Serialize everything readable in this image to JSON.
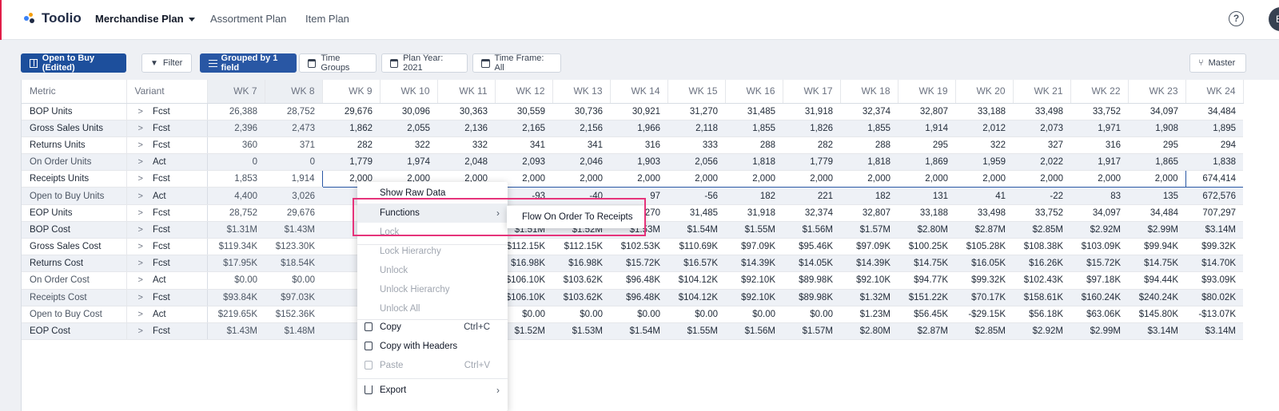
{
  "app": {
    "name": "Toolio"
  },
  "nav": {
    "items": [
      {
        "label": "Merchandise Plan",
        "active": true,
        "dropdown": true
      },
      {
        "label": "Assortment Plan"
      },
      {
        "label": "Item Plan"
      }
    ],
    "help_icon": "question-circle-icon",
    "avatar_initial": "B"
  },
  "toolbar": {
    "view_label": "Open to Buy (Edited)",
    "filter_label": "Filter",
    "grouped_label": "Grouped by 1 field",
    "time_groups_label": "Time Groups",
    "plan_year_label": "Plan Year: 2021",
    "time_frame_label": "Time Frame: All",
    "master_label": "Master"
  },
  "table": {
    "col_metric": "Metric",
    "col_variant": "Variant",
    "weeks": [
      "WK 7",
      "WK 8",
      "WK 9",
      "WK 10",
      "WK 11",
      "WK 12",
      "WK 13",
      "WK 14",
      "WK 15",
      "WK 16",
      "WK 17",
      "WK 18",
      "WK 19",
      "WK 20",
      "WK 21",
      "WK 22",
      "WK 23",
      "WK 24"
    ],
    "rows": [
      {
        "metric": "BOP Units",
        "variant": "Fcst",
        "values": [
          "26,388",
          "28,752",
          "29,676",
          "30,096",
          "30,363",
          "30,559",
          "30,736",
          "30,921",
          "31,270",
          "31,485",
          "31,918",
          "32,374",
          "32,807",
          "33,188",
          "33,498",
          "33,752",
          "34,097",
          "34,484"
        ]
      },
      {
        "metric": "Gross Sales Units",
        "variant": "Fcst",
        "values": [
          "2,396",
          "2,473",
          "1,862",
          "2,055",
          "2,136",
          "2,165",
          "2,156",
          "1,966",
          "2,118",
          "1,855",
          "1,826",
          "1,855",
          "1,914",
          "2,012",
          "2,073",
          "1,971",
          "1,908",
          "1,895"
        ]
      },
      {
        "metric": "Returns Units",
        "variant": "Fcst",
        "values": [
          "360",
          "371",
          "282",
          "322",
          "332",
          "341",
          "341",
          "316",
          "333",
          "288",
          "282",
          "288",
          "295",
          "322",
          "327",
          "316",
          "295",
          "294"
        ]
      },
      {
        "metric": "On Order Units",
        "variant": "Act",
        "values": [
          "0",
          "0",
          "1,779",
          "1,974",
          "2,048",
          "2,093",
          "2,046",
          "1,903",
          "2,056",
          "1,818",
          "1,779",
          "1,818",
          "1,869",
          "1,959",
          "2,022",
          "1,917",
          "1,865",
          "1,838"
        ]
      },
      {
        "metric": "Receipts Units",
        "variant": "Fcst",
        "values": [
          "1,853",
          "1,914",
          "2,000",
          "2,000",
          "2,000",
          "2,000",
          "2,000",
          "2,000",
          "2,000",
          "2,000",
          "2,000",
          "2,000",
          "2,000",
          "2,000",
          "2,000",
          "2,000",
          "2,000",
          "674,414"
        ]
      },
      {
        "metric": "Open to Buy Units",
        "variant": "Act",
        "values": [
          "4,400",
          "3,026",
          "",
          "",
          "",
          "-93",
          "-40",
          "97",
          "-56",
          "182",
          "221",
          "182",
          "131",
          "41",
          "-22",
          "83",
          "135",
          "672,576"
        ]
      },
      {
        "metric": "EOP Units",
        "variant": "Fcst",
        "values": [
          "28,752",
          "29,676",
          "30",
          "",
          "",
          "",
          "",
          "1,270",
          "31,485",
          "31,918",
          "32,374",
          "32,807",
          "33,188",
          "33,498",
          "33,752",
          "34,097",
          "34,484",
          "707,297"
        ]
      },
      {
        "metric": "BOP Cost",
        "variant": "Fcst",
        "values": [
          "$1.31M",
          "$1.43M",
          "$1",
          "",
          "",
          "$1.51M",
          "$1.52M",
          "$1.53M",
          "$1.54M",
          "$1.55M",
          "$1.56M",
          "$1.57M",
          "$2.80M",
          "$2.87M",
          "$2.85M",
          "$2.92M",
          "$2.99M",
          "$3.14M"
        ]
      },
      {
        "metric": "Gross Sales Cost",
        "variant": "Fcst",
        "values": [
          "$119.34K",
          "$123.30K",
          "$95",
          "",
          "",
          "$112.15K",
          "$112.15K",
          "$102.53K",
          "$110.69K",
          "$97.09K",
          "$95.46K",
          "$97.09K",
          "$100.25K",
          "$105.28K",
          "$108.38K",
          "$103.09K",
          "$99.94K",
          "$99.32K"
        ]
      },
      {
        "metric": "Returns Cost",
        "variant": "Fcst",
        "values": [
          "$17.95K",
          "$18.54K",
          "$14",
          "",
          "",
          "$16.98K",
          "$16.98K",
          "$15.72K",
          "$16.57K",
          "$14.39K",
          "$14.05K",
          "$14.39K",
          "$14.75K",
          "$16.05K",
          "$16.26K",
          "$15.72K",
          "$14.75K",
          "$14.70K"
        ]
      },
      {
        "metric": "On Order Cost",
        "variant": "Act",
        "values": [
          "$0.00",
          "$0.00",
          "$89",
          "",
          "",
          "$106.10K",
          "$103.62K",
          "$96.48K",
          "$104.12K",
          "$92.10K",
          "$89.98K",
          "$92.10K",
          "$94.77K",
          "$99.32K",
          "$102.43K",
          "$97.18K",
          "$94.44K",
          "$93.09K"
        ]
      },
      {
        "metric": "Receipts Cost",
        "variant": "Fcst",
        "values": [
          "$93.84K",
          "$97.03K",
          "$89",
          "",
          "",
          "$106.10K",
          "$103.62K",
          "$96.48K",
          "$104.12K",
          "$92.10K",
          "$89.98K",
          "$1.32M",
          "$151.22K",
          "$70.17K",
          "$158.61K",
          "$160.24K",
          "$240.24K",
          "$80.02K"
        ]
      },
      {
        "metric": "Open to Buy Cost",
        "variant": "Act",
        "values": [
          "$219.65K",
          "$152.36K",
          "$0",
          "",
          "",
          "$0.00",
          "$0.00",
          "$0.00",
          "$0.00",
          "$0.00",
          "$0.00",
          "$1.23M",
          "$56.45K",
          "-$29.15K",
          "$56.18K",
          "$63.06K",
          "$145.80K",
          "-$13.07K"
        ]
      },
      {
        "metric": "EOP Cost",
        "variant": "Fcst",
        "values": [
          "$1.43M",
          "$1.48M",
          "$1.",
          "",
          "",
          "$1.52M",
          "$1.53M",
          "$1.54M",
          "$1.55M",
          "$1.56M",
          "$1.57M",
          "$2.80M",
          "$2.87M",
          "$2.85M",
          "$2.92M",
          "$2.99M",
          "$3.14M",
          "$3.14M"
        ]
      }
    ]
  },
  "context_menu": {
    "show_raw_data": "Show Raw Data",
    "functions": "Functions",
    "lock": "Lock",
    "lock_hierarchy": "Lock Hierarchy",
    "unlock": "Unlock",
    "unlock_hierarchy": "Unlock Hierarchy",
    "unlock_all": "Unlock All",
    "copy": "Copy",
    "copy_shortcut": "Ctrl+C",
    "copy_with_headers": "Copy with Headers",
    "paste": "Paste",
    "paste_shortcut": "Ctrl+V",
    "export": "Export"
  },
  "submenu": {
    "flow_on_order": "Flow On Order To Receipts"
  },
  "colors": {
    "primary": "#1d4f9c",
    "highlight": "#e6337a"
  }
}
